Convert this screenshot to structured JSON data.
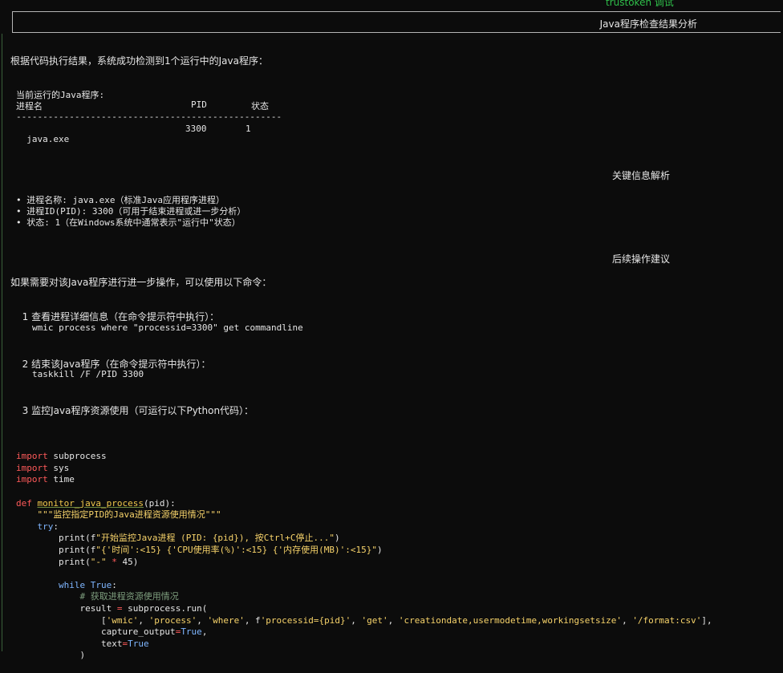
{
  "window": {
    "top_label": "trustoken 调试",
    "banner_title": "Java程序检查结果分析"
  },
  "intro": {
    "text": "根据代码执行结果，系统成功检测到1个运行中的Java程序："
  },
  "process_table": {
    "title": "当前运行的Java程序:",
    "headers": {
      "name": "进程名",
      "pid": "PID",
      "status": "状态"
    },
    "separator": "--------------------------------------------------",
    "rows": [
      {
        "name": "java.exe",
        "pid": "3300",
        "status": "1"
      }
    ]
  },
  "key_info": {
    "heading": "关键信息解析",
    "bullets": [
      "进程名称: java.exe（标准Java应用程序进程）",
      "进程ID(PID): 3300（可用于结束进程或进一步分析）",
      "状态: 1（在Windows系统中通常表示\"运行中\"状态）"
    ]
  },
  "next_steps": {
    "heading": "后续操作建议",
    "intro": "如果需要对该Java程序进行进一步操作，可以使用以下命令：",
    "steps": [
      {
        "number": "1",
        "text": "查看进程详细信息（在命令提示符中执行）：",
        "command": "wmic process where \"processid=3300\" get commandline"
      },
      {
        "number": "2",
        "text": "结束该Java程序（在命令提示符中执行）：",
        "command": "taskkill /F /PID 3300"
      },
      {
        "number": "3",
        "text": "监控Java程序资源使用（可运行以下Python代码）："
      }
    ]
  },
  "code": {
    "lines": [
      "import subprocess",
      "import sys",
      "import time",
      "",
      "def monitor_java_process(pid):",
      "    \"\"\"监控指定PID的Java进程资源使用情况\"\"\"",
      "    try:",
      "        print(f\"开始监控Java进程 (PID: {pid}), 按Ctrl+C停止...\")",
      "        print(f\"{'时间':<15} {'CPU使用率(%)':<15} {'内存使用(MB)':<15}\")",
      "        print(\"-\" * 45)",
      "",
      "        while True:",
      "            # 获取进程资源使用情况",
      "            result = subprocess.run(",
      "                ['wmic', 'process', 'where', f'processid={pid}', 'get', 'creationdate,usermodetime,workingsetsize', '/format:csv'],",
      "                capture_output=True,",
      "                text=True",
      "            )"
    ]
  }
}
